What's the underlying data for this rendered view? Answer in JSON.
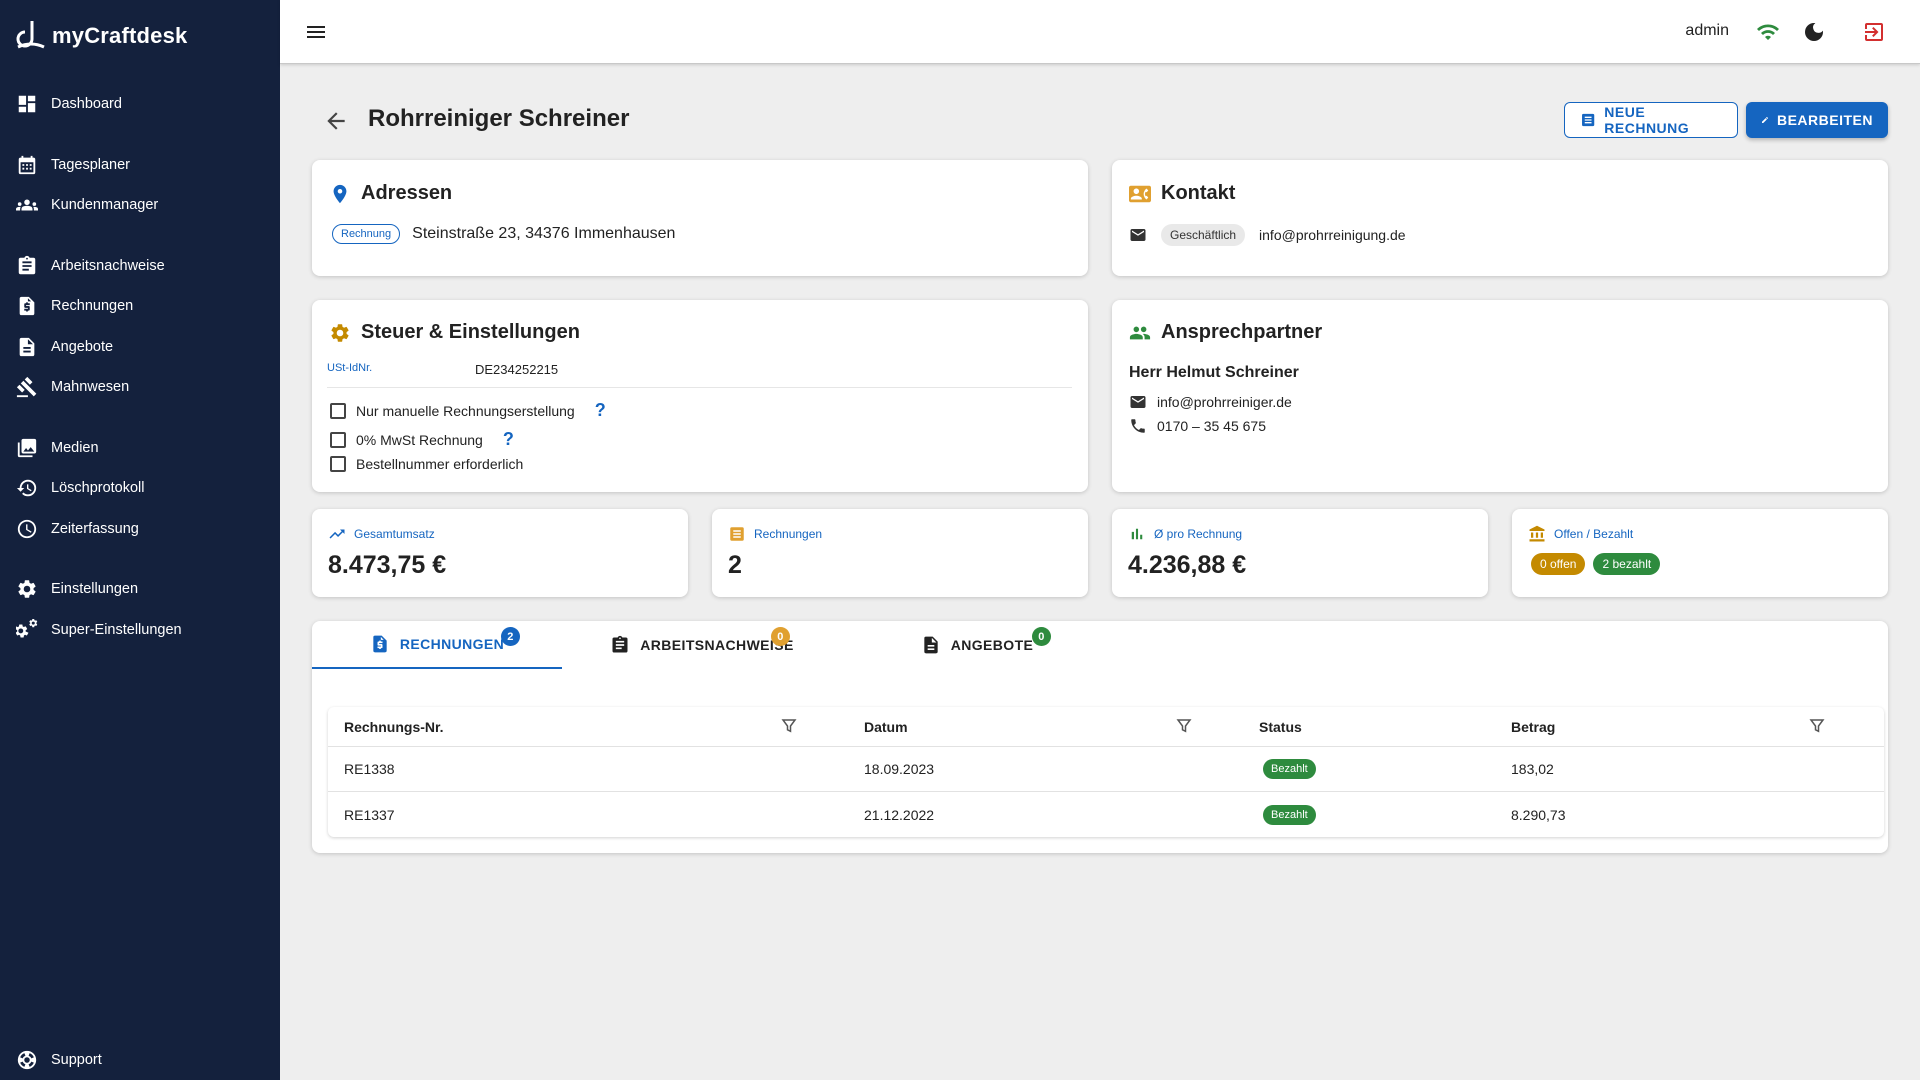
{
  "app": {
    "name": "myCraftdesk"
  },
  "sidebar": {
    "items": [
      {
        "label": "Dashboard",
        "icon": "dashboard-icon"
      },
      {
        "label": "Tagesplaner",
        "icon": "calendar-icon"
      },
      {
        "label": "Kundenmanager",
        "icon": "people-icon"
      },
      {
        "label": "Arbeitsnachweise",
        "icon": "clipboard-icon"
      },
      {
        "label": "Rechnungen",
        "icon": "invoice-icon"
      },
      {
        "label": "Angebote",
        "icon": "document-icon"
      },
      {
        "label": "Mahnwesen",
        "icon": "gavel-icon"
      },
      {
        "label": "Medien",
        "icon": "photo-library-icon"
      },
      {
        "label": "Löschprotokoll",
        "icon": "history-icon"
      },
      {
        "label": "Zeiterfassung",
        "icon": "clock-icon"
      },
      {
        "label": "Einstellungen",
        "icon": "gear-icon"
      },
      {
        "label": "Super-Einstellungen",
        "icon": "gears-icon"
      },
      {
        "label": "Support",
        "icon": "lifebuoy-icon"
      }
    ]
  },
  "topbar": {
    "user": "admin"
  },
  "page": {
    "title": "Rohrreiniger Schreiner",
    "new_invoice_label": "NEUE RECHNUNG",
    "edit_label": "BEARBEITEN"
  },
  "addresses": {
    "title": "Adressen",
    "chip": "Rechnung",
    "address": "Steinstraße 23, 34376 Immenhausen"
  },
  "contact": {
    "title": "Kontakt",
    "chip": "Geschäftlich",
    "email": "info@prohrreinigung.de"
  },
  "tax": {
    "title": "Steuer & Einstellungen",
    "ust_label": "USt-IdNr.",
    "ust_value": "DE234252215",
    "options": [
      {
        "label": "Nur manuelle Rechnungserstellung",
        "help": "?"
      },
      {
        "label": "0% MwSt Rechnung",
        "help": "?"
      },
      {
        "label": "Bestellnummer erforderlich",
        "help": ""
      }
    ]
  },
  "partner": {
    "title": "Ansprechpartner",
    "name": "Herr Helmut Schreiner",
    "email": "info@prohrreiniger.de",
    "phone": "0170 – 35 45 675"
  },
  "stats": {
    "revenue": {
      "label": "Gesamtumsatz",
      "value": "8.473,75 €"
    },
    "invoices": {
      "label": "Rechnungen",
      "value": "2"
    },
    "average": {
      "label": "Ø pro Rechnung",
      "value": "4.236,88 €"
    },
    "open_paid": {
      "label": "Offen / Bezahlt",
      "open": "0 offen",
      "paid": "2 bezahlt"
    }
  },
  "tabs": [
    {
      "label": "RECHNUNGEN",
      "badge": "2",
      "active": true
    },
    {
      "label": "ARBEITSNACHWEISE",
      "badge": "0",
      "active": false
    },
    {
      "label": "ANGEBOTE",
      "badge": "0",
      "active": false
    }
  ],
  "table": {
    "headers": [
      "Rechnungs-Nr.",
      "Datum",
      "Status",
      "Betrag"
    ],
    "rows": [
      {
        "number": "RE1338",
        "date": "18.09.2023",
        "status": "Bezahlt",
        "amount": "183,02"
      },
      {
        "number": "RE1337",
        "date": "21.12.2022",
        "status": "Bezahlt",
        "amount": "8.290,73"
      }
    ]
  },
  "colors": {
    "sidebar": "#14213d",
    "primary": "#1565c0",
    "success": "#2e8b3e",
    "warning": "#e0a030",
    "logout": "#d32f2f"
  }
}
